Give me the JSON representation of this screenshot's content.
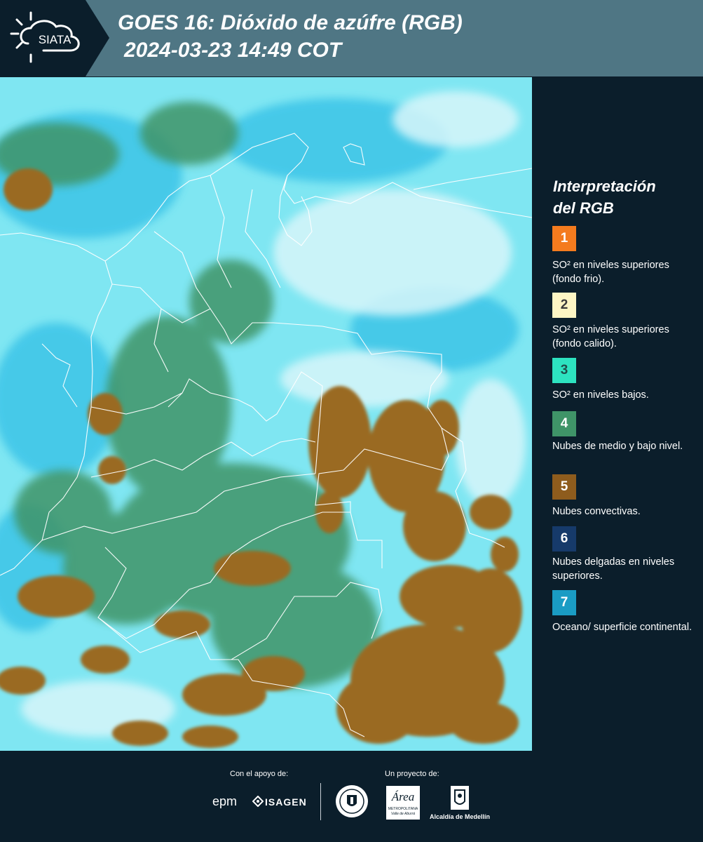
{
  "header": {
    "logo_text": "SIATA",
    "title_line1": "GOES 16: Dióxido de azúfre (RGB)",
    "title_line2": "2024-03-23 14:49 COT"
  },
  "legend": {
    "title_line1": "Interpretación",
    "title_line2": "del RGB",
    "items": [
      {
        "number": "1",
        "color": "#f47b1e",
        "text": "SO² en niveles superiores (fondo frio)."
      },
      {
        "number": "2",
        "color": "#fdf5c4",
        "text": "SO² en niveles superiores (fondo calido)."
      },
      {
        "number": "3",
        "color": "#2de3c0",
        "text": "SO² en niveles bajos."
      },
      {
        "number": "4",
        "color": "#3f9468",
        "text": "Nubes de medio y bajo nivel."
      },
      {
        "number": "5",
        "color": "#8e5c1d",
        "text": "Nubes convectivas."
      },
      {
        "number": "6",
        "color": "#163a6a",
        "text": "Nubes delgadas en niveles superiores."
      },
      {
        "number": "7",
        "color": "#1a9cc4",
        "text": "Oceano/ superficie continental."
      }
    ]
  },
  "footer": {
    "support_label": "Con el apoyo de:",
    "project_label": "Un proyecto de:",
    "sponsors": {
      "epm": "epm",
      "isagen": "ISAGEN",
      "area_word": "Área",
      "area_sub1": "METROPOLITANA",
      "area_sub2": "Valle de Aburrá",
      "alcaldia": "Alcaldía de Medellín"
    }
  },
  "map": {
    "colors": {
      "background_cyan": "#6fe0ee",
      "clear_sky": "#39c3e6",
      "haze": "#bfeef6",
      "low_cloud_green": "#3f9468",
      "convective_brown": "#9a6a24",
      "border_line": "#ffffff"
    }
  }
}
